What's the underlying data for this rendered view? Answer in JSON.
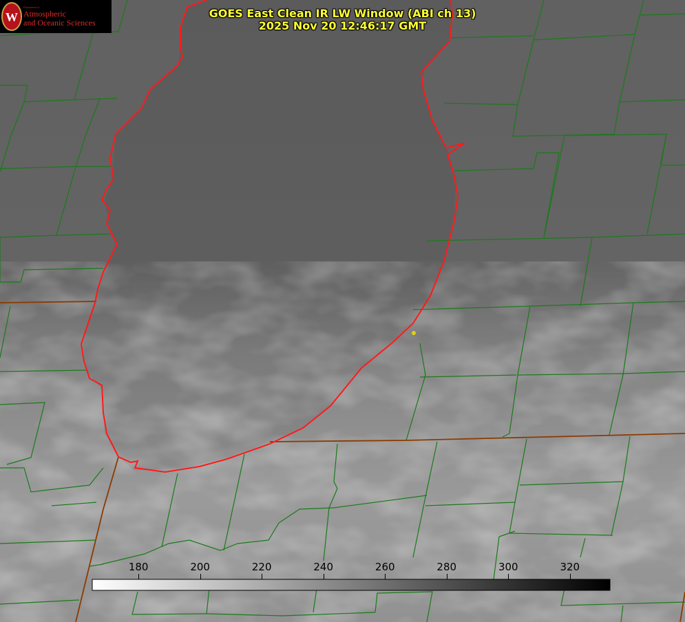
{
  "title": {
    "line1": "GOES East Clean IR LW Window (ABI ch 13)",
    "line2": "2025 Nov 20 12:46:17 GMT"
  },
  "logo": {
    "department": "Department of",
    "line1": "Atmospheric",
    "line2": "and Oceanic Sciences",
    "seal_letter": "W",
    "colors": {
      "background": "#000000",
      "text": "#dd2a2a",
      "seal": "#b5121b"
    }
  },
  "colorbar": {
    "range": [
      165,
      333
    ],
    "ticks": [
      180,
      200,
      220,
      240,
      260,
      280,
      300,
      320
    ],
    "scale": "white-to-black grayscale (cold = white, warm = black)"
  },
  "map": {
    "colors": {
      "county_lines": "#1a7a1a",
      "shoreline": "#ff1a1a",
      "state_border": "#8b3a00",
      "station_marker": "#e0d018",
      "lake_gray": "#5c5c5c",
      "land_gray": "#888888"
    }
  }
}
